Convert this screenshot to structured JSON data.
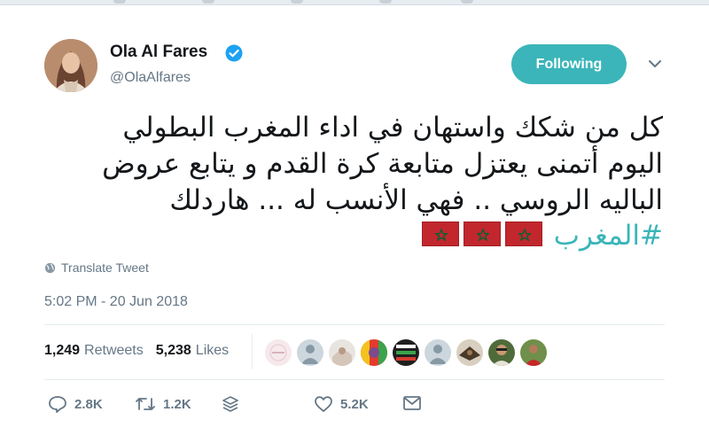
{
  "author": {
    "name": "Ola Al Fares",
    "handle": "@OlaAlfares",
    "verified": true
  },
  "follow_button": {
    "label": "Following"
  },
  "tweet": {
    "lines": [
      "كل من شكك  واستهان في اداء المغرب البطولي",
      "اليوم أتمنى يعتزل متابعة كرة القدم و يتابع عروض",
      "الباليه الروسي .. فهي الأنسب له ... هاردلك"
    ],
    "hashtag": "#المغرب",
    "flag_count": 3
  },
  "translate": {
    "label": "Translate Tweet"
  },
  "timestamp": "5:02 PM - 20 Jun 2018",
  "stats": {
    "retweets_count": "1,249",
    "retweets_label": "Retweets",
    "likes_count": "5,238",
    "likes_label": "Likes"
  },
  "actions": {
    "reply_count": "2.8K",
    "retweet_count": "1.2K",
    "like_count": "5.2K"
  },
  "colors": {
    "accent": "#3bb5b9",
    "flag_red": "#c1272d",
    "flag_star": "#006233"
  }
}
